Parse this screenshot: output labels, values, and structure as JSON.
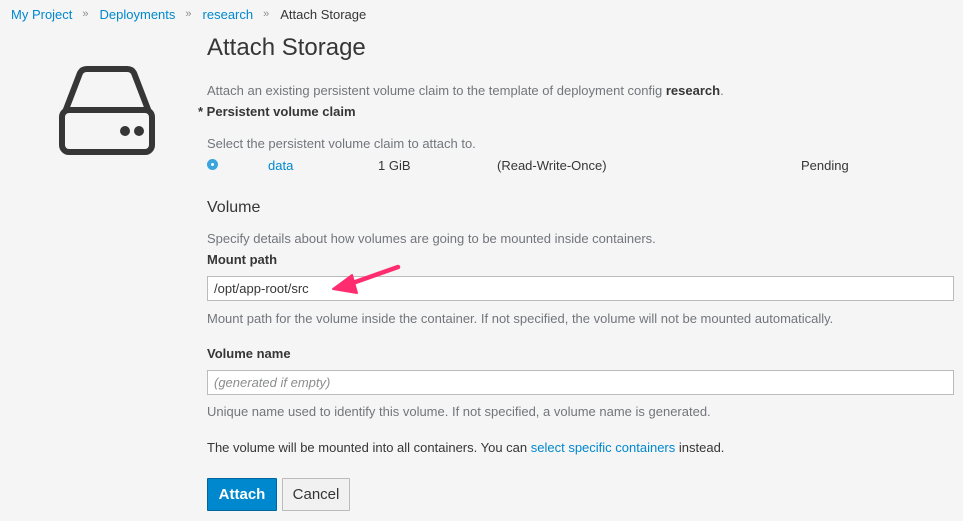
{
  "breadcrumb": {
    "items": [
      "My Project",
      "Deployments",
      "research"
    ],
    "separator": "»",
    "current": "Attach Storage"
  },
  "header": {
    "title": "Attach Storage",
    "intro_prefix": "Attach an existing persistent volume claim to the template of deployment config ",
    "intro_target": "research",
    "intro_suffix": "."
  },
  "pvc": {
    "label": "* Persistent volume claim",
    "help": "Select the persistent volume claim to attach to.",
    "rows": [
      {
        "name": "data",
        "size": "1 GiB",
        "access": "(Read-Write-Once)",
        "status": "Pending",
        "selected": true
      }
    ]
  },
  "volume": {
    "heading": "Volume",
    "help": "Specify details about how volumes are going to be mounted inside containers.",
    "mount_path": {
      "label": "Mount path",
      "value": "/opt/app-root/src",
      "help": "Mount path for the volume inside the container. If not specified, the volume will not be mounted automatically."
    },
    "volume_name": {
      "label": "Volume name",
      "value": "",
      "placeholder": "(generated if empty)",
      "help": "Unique name used to identify this volume. If not specified, a volume name is generated."
    }
  },
  "note": {
    "prefix": "The volume will be mounted into all containers. You can ",
    "link": "select specific containers",
    "suffix": " instead."
  },
  "actions": {
    "attach_label": "Attach",
    "cancel_label": "Cancel"
  },
  "icons": {
    "storage": "hard-drive-icon",
    "annotation": "arrow-annotation"
  },
  "colors": {
    "link": "#0088ce",
    "primary_button": "#0088ce",
    "annotation_arrow": "#ff2d6f"
  }
}
